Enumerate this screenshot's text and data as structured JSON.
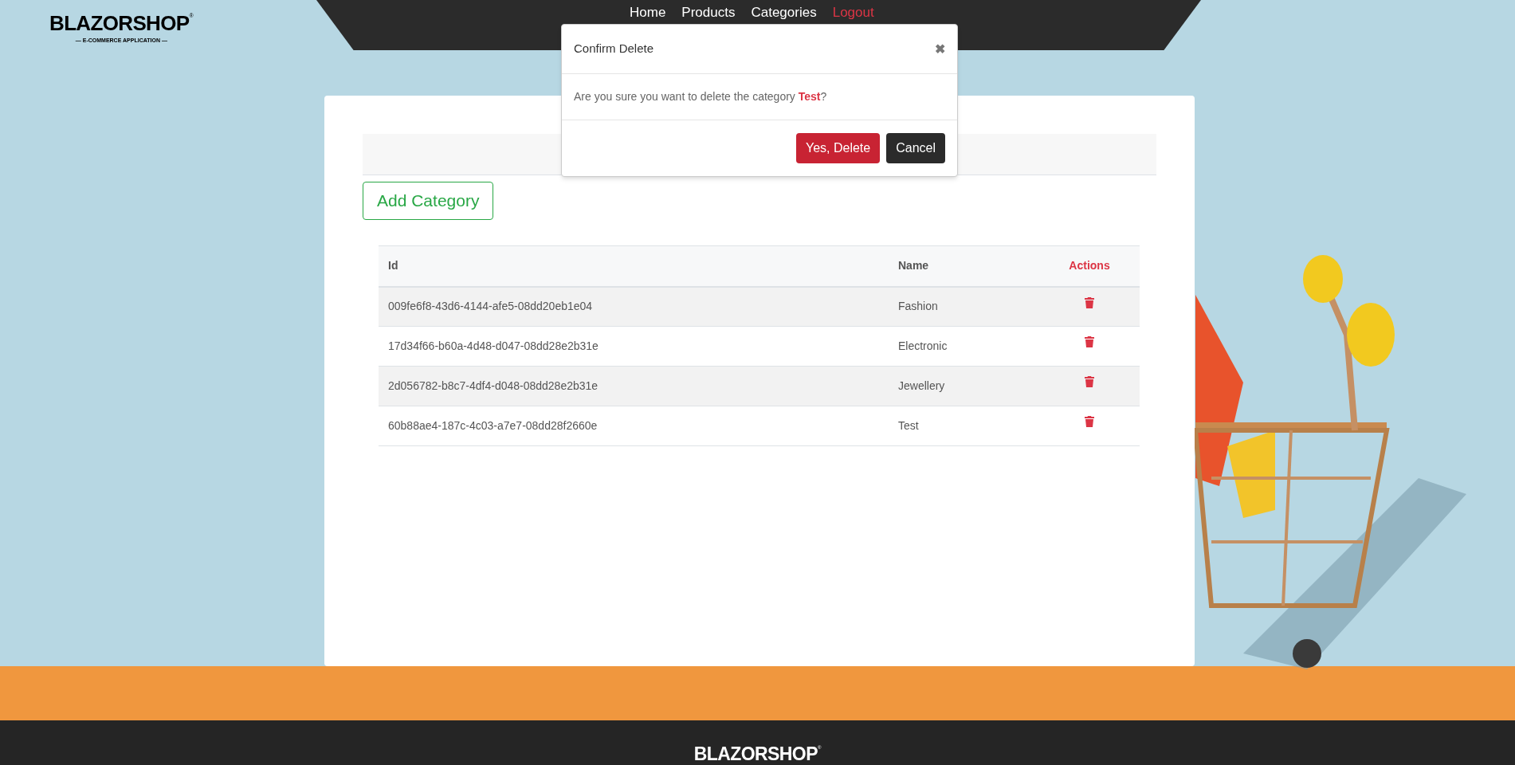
{
  "header": {
    "logo": {
      "title": "BLAZORSHOP",
      "mark": "®",
      "subtitle": "— E-COMMERCE APPLICATION —"
    },
    "nav": [
      {
        "label": "Home",
        "kind": "link"
      },
      {
        "label": "Products",
        "kind": "link"
      },
      {
        "label": "Categories",
        "kind": "link"
      },
      {
        "label": "Logout",
        "kind": "logout"
      }
    ]
  },
  "content": {
    "add_button": "Add Category",
    "table": {
      "columns": [
        {
          "label": "Id",
          "kind": "text"
        },
        {
          "label": "Name",
          "kind": "text"
        },
        {
          "label": "Actions",
          "kind": "actions"
        }
      ],
      "rows": [
        {
          "id": "009fe6f8-43d6-4144-afe5-08dd20eb1e04",
          "name": "Fashion"
        },
        {
          "id": "17d34f66-b60a-4d48-d047-08dd28e2b31e",
          "name": "Electronic"
        },
        {
          "id": "2d056782-b8c7-4df4-d048-08dd28e2b31e",
          "name": "Jewellery"
        },
        {
          "id": "60b88ae4-187c-4c03-a7e7-08dd28f2660e",
          "name": "Test"
        }
      ]
    }
  },
  "modal": {
    "title": "Confirm Delete",
    "close": "✖",
    "message": "Are you sure you want to delete the category **Test**?",
    "buttons": [
      {
        "label": "Yes, Delete",
        "kind": "danger"
      },
      {
        "label": "Cancel",
        "kind": "dark"
      }
    ]
  },
  "footer": {
    "logo": {
      "title": "BLAZORSHOP",
      "mark": "®"
    }
  }
}
